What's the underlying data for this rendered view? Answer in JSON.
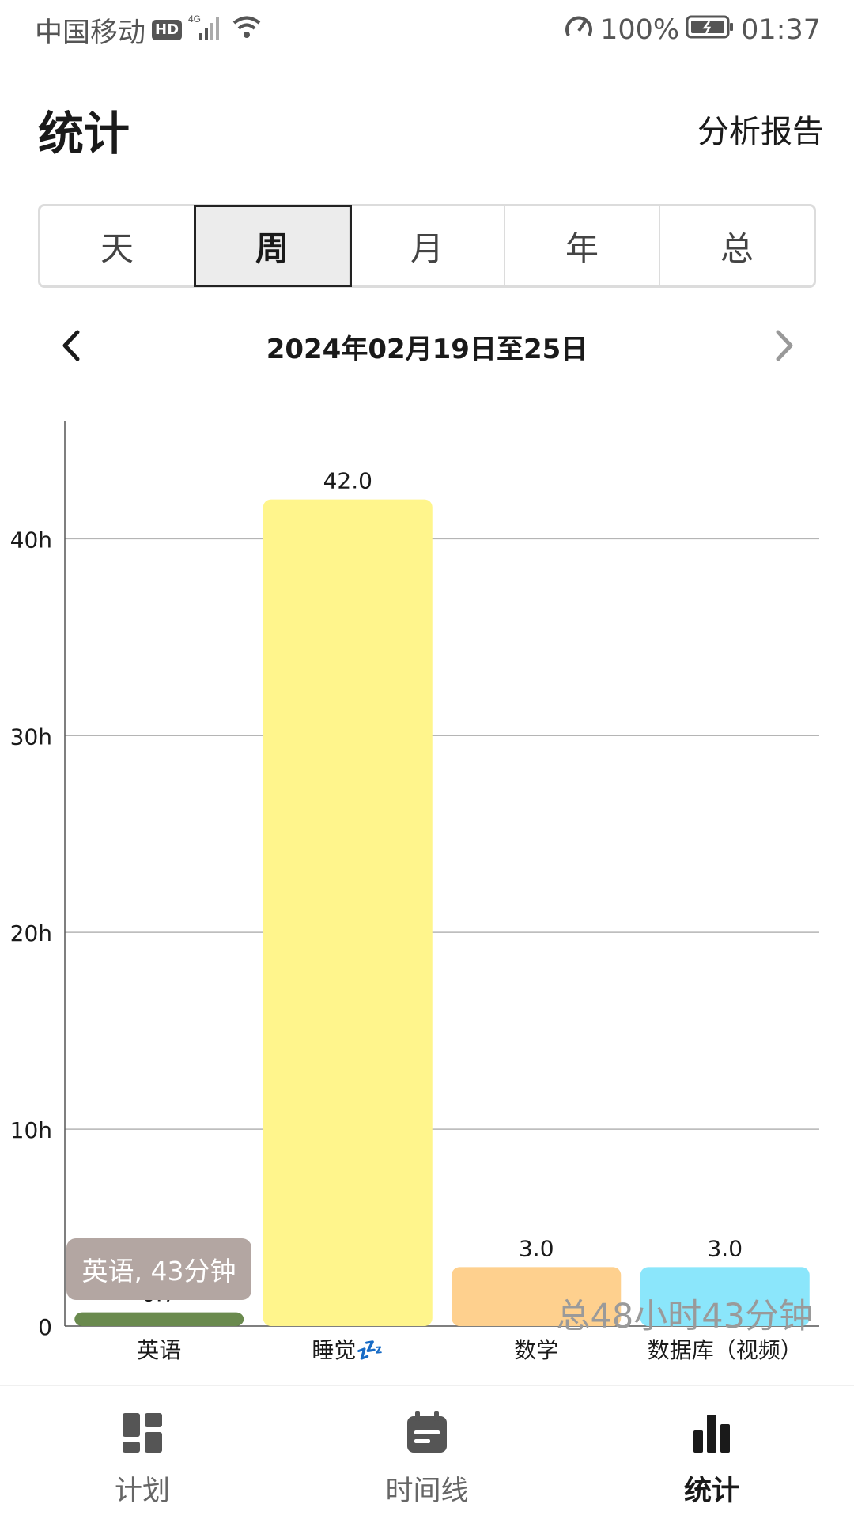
{
  "status_bar": {
    "carrier": "中国移动",
    "hd_badge": "HD",
    "network": "4G",
    "battery": "100%",
    "time": "01:37"
  },
  "header": {
    "title": "统计",
    "action_label": "分析报告"
  },
  "period_tabs": {
    "items": [
      "天",
      "周",
      "月",
      "年",
      "总"
    ],
    "selected": "周"
  },
  "range": {
    "label": "2024年02月19日至25日"
  },
  "tooltip": {
    "text": "英语, 43分钟"
  },
  "total": {
    "text": "总48小时43分钟"
  },
  "chart_data": {
    "type": "bar",
    "categories": [
      "英语",
      "睡觉💤",
      "数学",
      "数据库（视频）"
    ],
    "values": [
      0.7,
      42.0,
      3.0,
      3.0
    ],
    "value_labels": [
      "0.7",
      "42.0",
      "3.0",
      "3.0"
    ],
    "colors": [
      "#6a8a4e",
      "#fff58c",
      "#fed08e",
      "#8be6fb"
    ],
    "yticks": [
      "0",
      "10h",
      "20h",
      "30h",
      "40h"
    ],
    "ytick_values": [
      0,
      10,
      20,
      30,
      40
    ],
    "ylim": [
      0,
      46
    ],
    "grid": true
  },
  "bottom_nav": {
    "items": [
      {
        "label": "计划",
        "icon": "dashboard-icon"
      },
      {
        "label": "时间线",
        "icon": "calendar-icon"
      },
      {
        "label": "统计",
        "icon": "bar-chart-icon"
      }
    ],
    "selected": "统计"
  }
}
